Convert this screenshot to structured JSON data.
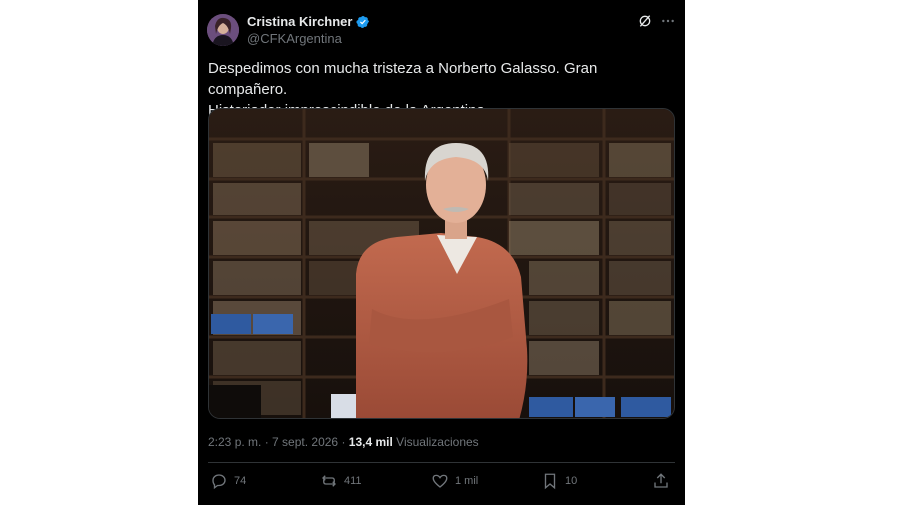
{
  "tweet": {
    "author_name": "Cristina Kirchner",
    "author_handle": "@CFKArgentina",
    "text_line1": "Despedimos con mucha tristeza a Norberto Galasso. Gran compañero.",
    "text_line2": "Historiador imprescindible de la Argentina.",
    "time": "2:23 p. m.",
    "separator": " · ",
    "date": "7 sept. 2026",
    "views_count": "13,4 mil",
    "views_label": "Visualizaciones"
  },
  "actions": {
    "replies": "74",
    "retweets": "411",
    "likes": "1 mil",
    "bookmarks": "10"
  },
  "colors": {
    "background": "#000000",
    "text": "#e7e9ea",
    "secondary": "#71767b",
    "verified": "#1d9bf0"
  }
}
